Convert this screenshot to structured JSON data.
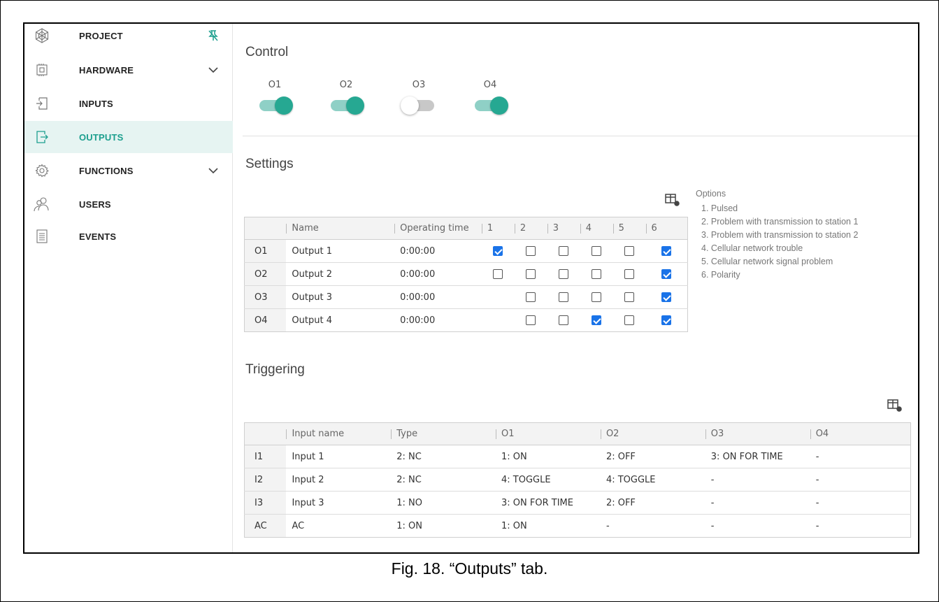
{
  "sidebar": {
    "items": [
      {
        "label": "PROJECT",
        "icon": "project-icon",
        "extra": "pin-icon"
      },
      {
        "label": "HARDWARE",
        "icon": "hardware-icon",
        "extra": "chevron-down-icon"
      },
      {
        "label": "INPUTS",
        "icon": "inputs-icon"
      },
      {
        "label": "OUTPUTS",
        "icon": "outputs-icon",
        "active": true
      },
      {
        "label": "FUNCTIONS",
        "icon": "gear-icon",
        "extra": "chevron-down-icon"
      },
      {
        "label": "USERS",
        "icon": "users-icon"
      },
      {
        "label": "EVENTS",
        "icon": "events-icon"
      }
    ]
  },
  "control": {
    "title": "Control",
    "toggles": [
      {
        "label": "O1",
        "on": true
      },
      {
        "label": "O2",
        "on": true
      },
      {
        "label": "O3",
        "on": false
      },
      {
        "label": "O4",
        "on": true
      }
    ]
  },
  "settings": {
    "title": "Settings",
    "headers": [
      "",
      "Name",
      "Operating time",
      "1",
      "2",
      "3",
      "4",
      "5",
      "6"
    ],
    "rows": [
      {
        "id": "O1",
        "name": "Output 1",
        "time": "0:00:00",
        "checks": [
          true,
          false,
          false,
          false,
          false,
          true
        ]
      },
      {
        "id": "O2",
        "name": "Output 2",
        "time": "0:00:00",
        "checks": [
          false,
          false,
          false,
          false,
          false,
          true
        ]
      },
      {
        "id": "O3",
        "name": "Output 3",
        "time": "0:00:00",
        "checks": [
          null,
          false,
          false,
          false,
          false,
          true
        ]
      },
      {
        "id": "O4",
        "name": "Output 4",
        "time": "0:00:00",
        "checks": [
          null,
          false,
          false,
          true,
          false,
          true
        ]
      }
    ],
    "options_title": "Options",
    "options": [
      "1. Pulsed",
      "2. Problem with transmission to station 1",
      "3. Problem with transmission to station 2",
      "4. Cellular network trouble",
      "5. Cellular network signal problem",
      "6. Polarity"
    ]
  },
  "triggering": {
    "title": "Triggering",
    "headers": [
      "",
      "Input name",
      "Type",
      "O1",
      "O2",
      "O3",
      "O4"
    ],
    "rows": [
      [
        "I1",
        "Input 1",
        "2: NC",
        "1: ON",
        "2: OFF",
        "3: ON FOR TIME",
        "-"
      ],
      [
        "I2",
        "Input 2",
        "2: NC",
        "4: TOGGLE",
        "4: TOGGLE",
        "-",
        "-"
      ],
      [
        "I3",
        "Input 3",
        "1: NO",
        "3: ON FOR TIME",
        "2: OFF",
        "-",
        "-"
      ],
      [
        "AC",
        "AC",
        "1: ON",
        "1: ON",
        "-",
        "-",
        "-"
      ]
    ]
  },
  "caption": "Fig. 18. “Outputs” tab."
}
